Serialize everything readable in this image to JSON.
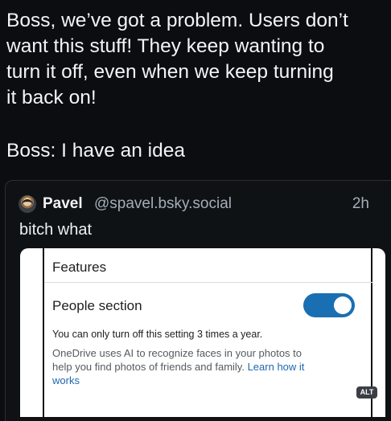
{
  "post": {
    "lines": [
      "Boss, we’ve got a problem. Users don’t",
      "want this stuff! They keep wanting to",
      "turn it off, even when we keep turning",
      "it back on!",
      "Boss: I have an idea"
    ]
  },
  "quote": {
    "author_name": "Pavel",
    "author_handle": "@spavel.bsky.social",
    "time_ago": "2h",
    "text": "bitch what",
    "embed": {
      "section_title": "Features",
      "setting_label": "People section",
      "toggle_state": "on",
      "limit_text": "You can only turn off this setting 3 times a year.",
      "description": "OneDrive uses AI to recognize faces in your photos to help you find photos of friends and family. ",
      "learn_link": "Learn how it works",
      "alt_badge": "ALT",
      "toggle_color": "#1a6fb3"
    }
  }
}
